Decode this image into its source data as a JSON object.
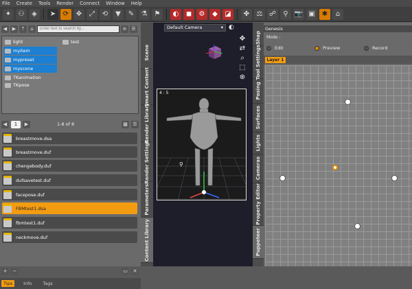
{
  "menu": [
    "File",
    "Create",
    "Tools",
    "Render",
    "Connect",
    "Window",
    "Help"
  ],
  "toolbar_icons": [
    "new-scene-icon",
    "figure-icon",
    "node-icon",
    "rotate-icon",
    "universal-icon",
    "scale-icon",
    "geometry-icon",
    "transform-icon",
    "joint-icon",
    "paint-icon",
    "spot-render-icon",
    "render-icon",
    "render-settings-icon",
    "iray-icon",
    "save-icon",
    "mannequin-icon",
    "camera-icon",
    "screenshot-icon",
    "tip-icon",
    "help-icon"
  ],
  "left": {
    "search_placeholder": "Enter text to search by...",
    "folders_left": [
      {
        "label": "light",
        "selected": false
      },
      {
        "label": "myitem",
        "selected": true
      },
      {
        "label": "mypreset",
        "selected": true
      },
      {
        "label": "myscene",
        "selected": true
      },
      {
        "label": "TKanimation",
        "selected": false
      },
      {
        "label": "TKpose",
        "selected": false
      }
    ],
    "folders_right": [
      {
        "label": "test"
      }
    ],
    "page": "1",
    "page_count": "1-8 of 8",
    "files": [
      {
        "label": "breastmove.dsa",
        "selected": false
      },
      {
        "label": "breastmove.duf",
        "selected": false
      },
      {
        "label": "chengebody.duf",
        "selected": false
      },
      {
        "label": "dufsavetest.duf",
        "selected": false
      },
      {
        "label": "facepose.duf",
        "selected": false
      },
      {
        "label": "FBMtest1.dsa",
        "selected": true
      },
      {
        "label": "fbmtest1.duf",
        "selected": false
      },
      {
        "label": "neckmove.duf",
        "selected": false
      }
    ],
    "bottom_tabs": [
      "Tips",
      "Info",
      "Tags"
    ],
    "side_tabs": [
      "Scene",
      "Smart Content",
      "Render Library",
      "Render Settings",
      "Parameters",
      "Content Library"
    ]
  },
  "viewport": {
    "camera": "Default Camera",
    "ratio": "4 : 5",
    "side_tabs": [
      "Shap",
      "Tool Settings",
      "Posing",
      "Surfaces",
      "Lights",
      "Cameras",
      "Property Editor",
      "Puppeteer"
    ]
  },
  "right": {
    "title": "Genesis",
    "mode_label": "Mode :",
    "modes": [
      {
        "label": "Edit",
        "on": false
      },
      {
        "label": "Preview",
        "on": true
      },
      {
        "label": "Record",
        "on": false
      }
    ],
    "layer": "Layer 1"
  },
  "colors": {
    "accent": "#f39c12",
    "selection": "#1d7fd1",
    "active_tool": "#b52a2a"
  }
}
